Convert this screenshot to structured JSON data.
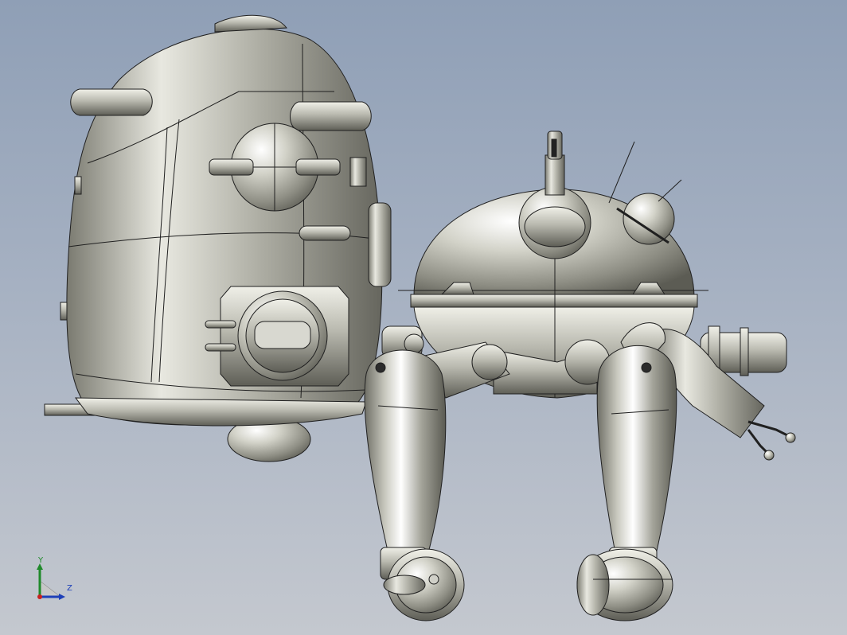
{
  "viewport": {
    "background_top": "#8f9fb6",
    "background_bottom": "#c4c8cf"
  },
  "model": {
    "part_color": "#b4b4a8",
    "edge_color": "#202020"
  },
  "triad": {
    "y_label": "Y",
    "z_label": "Z",
    "y_color": "#1f8a2a",
    "z_color": "#1d3fb8",
    "x_color": "#c82020"
  }
}
